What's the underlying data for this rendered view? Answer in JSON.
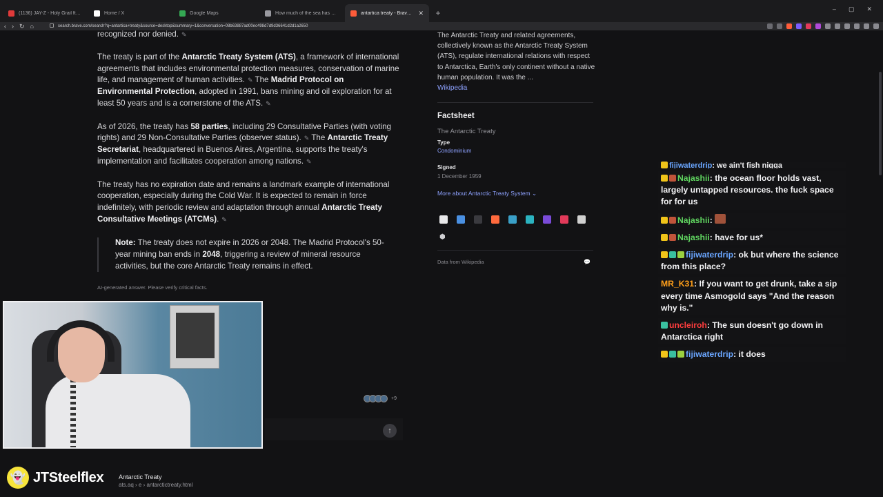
{
  "tabs": [
    {
      "label": "(1136) JAY-Z - Holy Grail ft. Justin Timberlake",
      "favicon_color": "#e03a3a",
      "active": false
    },
    {
      "label": "Home / X",
      "favicon_color": "#ffffff",
      "active": false
    },
    {
      "label": "Google Maps",
      "favicon_color": "#34a853",
      "active": false
    },
    {
      "label": "How much of the sea has been explored",
      "favicon_color": "#9a9aa0",
      "active": false
    },
    {
      "label": "antartica treaty - Brave Search",
      "favicon_color": "#ff5c3a",
      "active": true
    }
  ],
  "new_tab": "+",
  "window_controls": [
    "–",
    "▢",
    "✕"
  ],
  "nav": {
    "back": "‹",
    "forward": "›",
    "reload": "↻",
    "bookmark": "⌂"
  },
  "address": "search.brave.com/search?q=antartica+treaty&source=desktop&summary=1&conversation=08b63887ad00ec498d7d9d36641d2d1a2650",
  "answer": {
    "top_fragment": "recognized nor denied.",
    "p1_a": "The treaty is part of the ",
    "p1_b": "Antarctic Treaty System (ATS)",
    "p1_c": ", a framework of international agreements that includes environmental protection measures, conservation of marine life, and management of human activities.",
    "p1_d": " The ",
    "p1_e": "Madrid Protocol on Environmental Protection",
    "p1_f": ", adopted in 1991, bans mining and oil exploration for at least 50 years and is a cornerstone of the ATS.",
    "p2_a": "As of 2026, the treaty has ",
    "p2_b": "58 parties",
    "p2_c": ", including 29 Consultative Parties (with voting rights) and 29 Non-Consultative Parties (observer status).",
    "p2_d": " The ",
    "p2_e": "Antarctic Treaty Secretariat",
    "p2_f": ", headquartered in Buenos Aires, Argentina, supports the treaty's implementation and facilitates cooperation among nations.",
    "p3_a": "The treaty has no expiration date and remains a landmark example of international cooperation, especially during the Cold War. It is expected to remain in force indefinitely, with periodic review and adaptation through annual ",
    "p3_b": "Antarctic Treaty Consultative Meetings (ATCMs)",
    "p3_c": ".",
    "note_label": "Note:",
    "note_a": " The treaty does not expire in 2026 or 2048. The Madrid Protocol's 50-year mining ban ends in ",
    "note_b": "2048",
    "note_c": ", triggering a review of mineral resource activities, but the core Antarctic Treaty remains in effect.",
    "disclaimer": "AI-generated answer. Please verify critical facts.",
    "edit_icon": "✎"
  },
  "info": {
    "description": "The Antarctic Treaty and related agreements, collectively known as the Antarctic Treaty System (ATS), regulate international relations with respect to Antarctica, Earth's only continent without a native human population. It was the ...",
    "source_link": "Wikipedia",
    "factsheet_title": "Factsheet",
    "factsheet_sub": "The Antarctic Treaty",
    "type_label": "Type",
    "type_value": "Condominium",
    "signed_label": "Signed",
    "signed_value": "1 December 1959",
    "more": "More about Antarctic Treaty System ⌄",
    "data_from": "Data from Wikipedia",
    "comment_icon": "💬"
  },
  "source_icon_colors": [
    "#e8e8ea",
    "#4a90e2",
    "#1d1d1f",
    "#ff6a3d",
    "#3aa0c8",
    "#2bb3c0",
    "#7a4bd8",
    "#e23a5a",
    "#d0d0d0"
  ],
  "chat": [
    {
      "user": "fijiwaterdrip",
      "text": "we ain't fish nigga",
      "user_class": "u-fiji"
    },
    {
      "user": "Najashii",
      "text": "the ocean floor holds vast, largely untapped resources. the fuck space for for us",
      "user_class": "u-naj"
    },
    {
      "user": "Najashii",
      "text": "",
      "user_class": "u-naj"
    },
    {
      "user": "Najashii",
      "text": "have for us*",
      "user_class": "u-naj"
    },
    {
      "user": "fijiwaterdrip",
      "text": "ok but where the science from this place?",
      "user_class": "u-fiji"
    },
    {
      "user": "MR_K31",
      "text": "If you want to get drunk, take a sip every time Asmogold says \"And the reason why is.\"",
      "user_class": "u-mr"
    },
    {
      "user": "uncleiroh",
      "text": "The sun doesn't go down in Antarctica right",
      "user_class": "u-unc"
    },
    {
      "user": "fijiwaterdrip",
      "text": "it does",
      "user_class": "u-fiji"
    }
  ],
  "ask": {
    "send_icon": "↑",
    "count": "+9"
  },
  "overlay": {
    "snap_name": "JTSteelflex",
    "ghost_icon": "👻"
  },
  "footer_source": {
    "title": "Antarctic Treaty",
    "url": "ats.aq › e › antarctictreaty.html"
  }
}
